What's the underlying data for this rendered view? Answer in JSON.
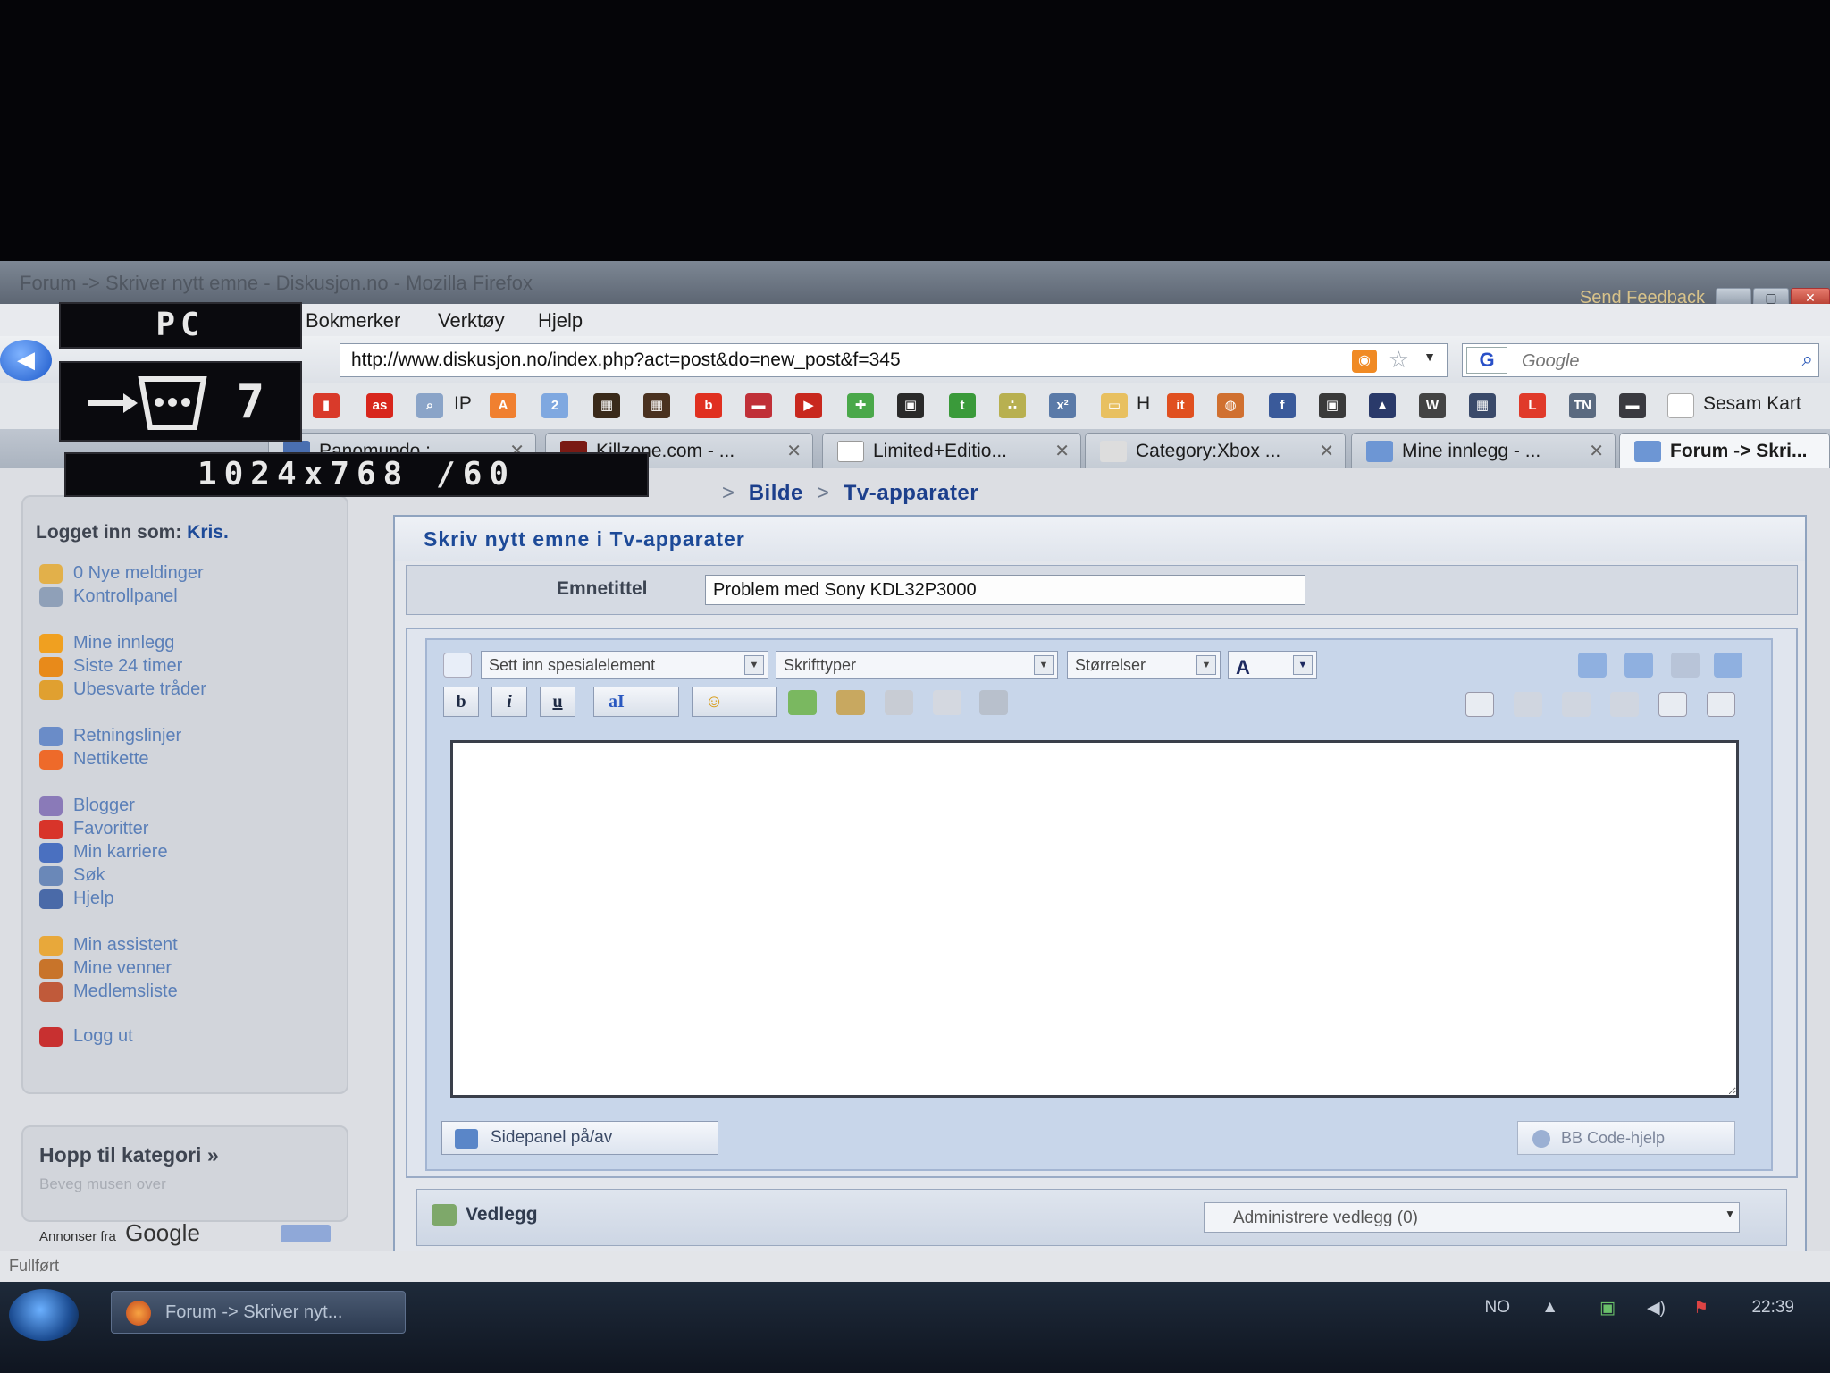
{
  "window": {
    "title": "Forum -> Skriver nytt emne - Diskusjon.no - Mozilla Firefox",
    "send_feedback": "Send Feedback"
  },
  "menu": [
    "Bokmerker",
    "Verktøy",
    "Hjelp"
  ],
  "nav": {
    "url": "http://www.diskusjon.no/index.php?act=post&do=new_post&f=345",
    "search_placeholder": "Google"
  },
  "bookmarks": {
    "ip_label": "IP",
    "h_label": "H",
    "sesam_label": "Sesam Kart"
  },
  "tabs": [
    {
      "label": "Panomundo : ...",
      "color": "#4a6fb0"
    },
    {
      "label": "Killzone.com - ...",
      "color": "#7a1a14"
    },
    {
      "label": "Limited+Editio...",
      "color": "#ffffff"
    },
    {
      "label": "Category:Xbox ...",
      "color": "#dddddd"
    },
    {
      "label": "Mine innlegg - ...",
      "color": "#6d96d4"
    },
    {
      "label": "Forum -> Skri...",
      "color": "#6d96d4"
    }
  ],
  "breadcrumb": {
    "part1": "Bilde",
    "part2": "Tv-apparater",
    "separator": ">"
  },
  "sidebar": {
    "logged_in_label": "Logget inn som:",
    "username": "Kris.",
    "items": [
      {
        "label": "0 Nye meldinger",
        "icon": "mail-icon",
        "color": "#e2b04a"
      },
      {
        "label": "Kontrollpanel",
        "icon": "tools-icon",
        "color": "#8fa0b8"
      },
      {
        "label": "Mine innlegg",
        "icon": "smiley-icon",
        "color": "#f0a020"
      },
      {
        "label": "Siste 24 timer",
        "icon": "clock-icon",
        "color": "#e88a1a"
      },
      {
        "label": "Ubesvarte tråder",
        "icon": "folder-icon",
        "color": "#e0a030"
      },
      {
        "label": "Retningslinjer",
        "icon": "book-icon",
        "color": "#6a8cc8"
      },
      {
        "label": "Nettikette",
        "icon": "warning-icon",
        "color": "#ee6a2a"
      },
      {
        "label": "Blogger",
        "icon": "blog-icon",
        "color": "#8a7ab8"
      },
      {
        "label": "Favoritter",
        "icon": "heart-icon",
        "color": "#d8342a"
      },
      {
        "label": "Min karriere",
        "icon": "people-icon",
        "color": "#4a70c0"
      },
      {
        "label": "Søk",
        "icon": "magnifier-icon",
        "color": "#6a88b8"
      },
      {
        "label": "Hjelp",
        "icon": "help-icon",
        "color": "#4a6aa8"
      },
      {
        "label": "Min assistent",
        "icon": "assistant-icon",
        "color": "#e8a83a"
      },
      {
        "label": "Mine venner",
        "icon": "friends-icon",
        "color": "#c8742a"
      },
      {
        "label": "Medlemsliste",
        "icon": "members-icon",
        "color": "#c05a3a"
      },
      {
        "label": "Logg ut",
        "icon": "logout-icon",
        "color": "#c83030"
      }
    ]
  },
  "jump": {
    "title": "Hopp til kategori »",
    "subtitle": "Beveg musen over"
  },
  "ads": {
    "prefix": "Annonser fra",
    "brand": "Google"
  },
  "form": {
    "title": "Skriv nytt emne i Tv-apparater",
    "subject_label": "Emnetittel",
    "subject_value": "Problem med Sony KDL32P3000"
  },
  "editor": {
    "special_select": "Sett inn spesialelement",
    "font_select": "Skrifttyper",
    "size_select": "Størrelser",
    "color_btn": "A",
    "bold": "b",
    "italic": "i",
    "underline": "u",
    "font_color_btn": "aI",
    "sidepanel_btn": "Sidepanel på/av",
    "bbcode_btn": "BB Code-hjelp"
  },
  "attachments": {
    "label": "Vedlegg",
    "manage": "Administrere vedlegg (0)"
  },
  "status": "Fullført",
  "taskbar": {
    "task_label": "Forum -> Skriver nyt...",
    "lang": "NO",
    "time": "22:39"
  },
  "overlay": {
    "source": "PC",
    "input_number": "7",
    "resolution": "1024x768 /60"
  }
}
